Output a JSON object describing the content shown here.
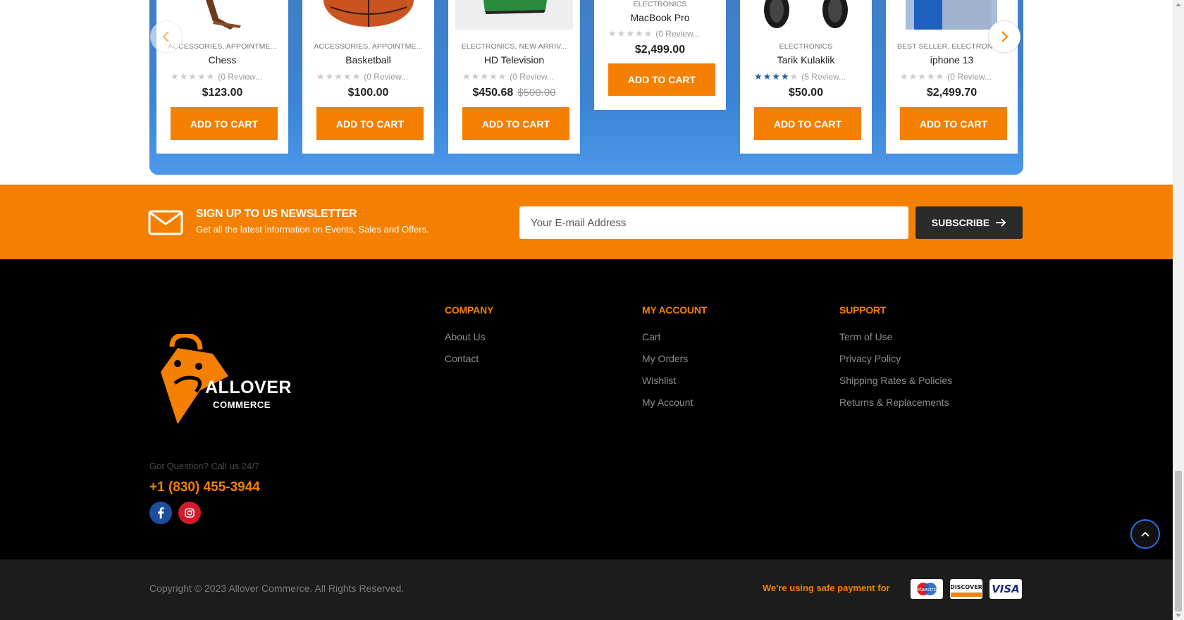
{
  "products": [
    {
      "cats": "ACCESSORIES, APPOINTME...",
      "name": "Chess",
      "rating": 0,
      "reviews": "(0 Review...",
      "price": "$123.00",
      "old_price": "",
      "cta": "ADD TO CART"
    },
    {
      "cats": "ACCESSORIES, APPOINTME...",
      "name": "Basketball",
      "rating": 0,
      "reviews": "(0 Review...",
      "price": "$100.00",
      "old_price": "",
      "cta": "ADD TO CART"
    },
    {
      "cats": "ELECTRONICS, NEW ARRIV...",
      "name": "HD Television",
      "rating": 0,
      "reviews": "(0 Review...",
      "price": "$450.68",
      "old_price": "$500.00",
      "cta": "ADD TO CART"
    },
    {
      "cats": "ELECTRONICS",
      "name": "MacBook Pro",
      "rating": 0,
      "reviews": "(0 Review...",
      "price": "$2,499.00",
      "old_price": "",
      "cta": "ADD TO CART"
    },
    {
      "cats": "ELECTRONICS",
      "name": "Tarik Kulaklik",
      "rating": 4,
      "reviews": "(5 Review...",
      "price": "$50.00",
      "old_price": "",
      "cta": "ADD TO CART"
    },
    {
      "cats": "BEST SELLER, ELECTRONIC...",
      "name": "iphone 13",
      "rating": 0,
      "reviews": "(0 Review...",
      "price": "$2,499.70",
      "old_price": "",
      "cta": "ADD TO CART"
    }
  ],
  "carousel": {
    "prev_icon": "chevron-left-icon",
    "next_icon": "chevron-right-icon"
  },
  "newsletter": {
    "title": "SIGN UP TO US NEWSLETTER",
    "subtitle": "Get all the latest information on Events, Sales and Offers.",
    "placeholder": "Your E-mail Address",
    "button": "SUBSCRIBE",
    "icon": "mail-icon"
  },
  "brand": {
    "name_line1": "ALLOVER",
    "name_line2": "COMMERCE"
  },
  "contact": {
    "question": "Got Question? Call us 24/7",
    "phone": "+1 (830) 455-3944"
  },
  "social": [
    {
      "name": "facebook-icon"
    },
    {
      "name": "instagram-icon"
    }
  ],
  "footer": {
    "company": {
      "title": "COMPANY",
      "links": [
        "About Us",
        "Contact"
      ]
    },
    "account": {
      "title": "MY ACCOUNT",
      "links": [
        "Cart",
        "My Orders",
        "Wishlist",
        "My Account"
      ]
    },
    "support": {
      "title": "SUPPORT",
      "links": [
        "Term of Use",
        "Privacy Policy",
        "Shipping Rates & Policies",
        "Returns & Replacements"
      ]
    }
  },
  "bottom": {
    "copyright": "Copyright © 2023 Allover Commerce. All Rights Reserved.",
    "safe_payment": "We're using safe payment for",
    "cards": [
      "Maestro",
      "DISCOVER",
      "VISA"
    ]
  },
  "colors": {
    "accent": "#f58000",
    "carousel_blue": "#3b84d6",
    "footer_bg": "#000000",
    "bottom_bg": "#1c1c1c",
    "star_on": "#1f5fa8"
  }
}
